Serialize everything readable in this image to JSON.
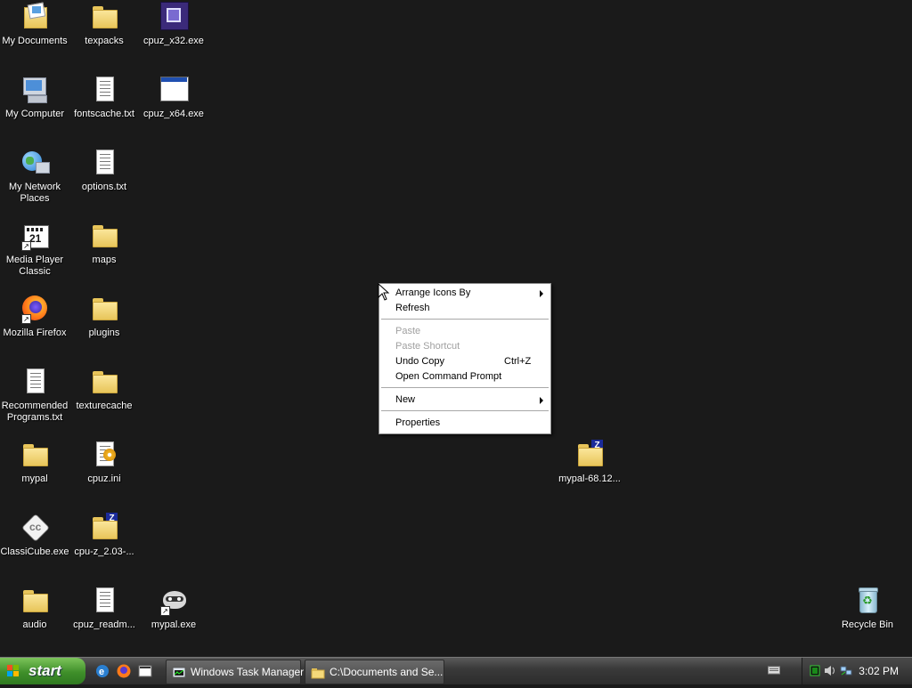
{
  "desktop": {
    "icons": [
      {
        "label": "My Documents",
        "icon": "my-documents-icon"
      },
      {
        "label": "texpacks",
        "icon": "folder-icon"
      },
      {
        "label": "cpuz_x32.exe",
        "icon": "cpuz-chip-icon"
      },
      {
        "label": "My Computer",
        "icon": "my-computer-icon"
      },
      {
        "label": "fontscache.txt",
        "icon": "text-file-icon"
      },
      {
        "label": "cpuz_x64.exe",
        "icon": "window-app-icon"
      },
      {
        "label": "My Network Places",
        "icon": "network-places-icon"
      },
      {
        "label": "options.txt",
        "icon": "text-file-icon"
      },
      {
        "label": "Media Player Classic",
        "icon": "media-player-classic-icon"
      },
      {
        "label": "maps",
        "icon": "folder-icon"
      },
      {
        "label": "Mozilla Firefox",
        "icon": "firefox-icon"
      },
      {
        "label": "plugins",
        "icon": "folder-icon"
      },
      {
        "label": "Recommended Programs.txt",
        "icon": "text-file-icon"
      },
      {
        "label": "texturecache",
        "icon": "folder-icon"
      },
      {
        "label": "mypal",
        "icon": "folder-icon"
      },
      {
        "label": "cpuz.ini",
        "icon": "ini-settings-icon"
      },
      {
        "label": "mypal-68.12...",
        "icon": "zip-folder-icon"
      },
      {
        "label": "ClassiCube.exe",
        "icon": "classicube-icon"
      },
      {
        "label": "cpu-z_2.03-...",
        "icon": "zip-folder-icon"
      },
      {
        "label": "audio",
        "icon": "folder-icon"
      },
      {
        "label": "cpuz_readm...",
        "icon": "text-file-icon"
      },
      {
        "label": "mypal.exe",
        "icon": "mypal-raccoon-icon"
      },
      {
        "label": "Recycle Bin",
        "icon": "recycle-bin-icon"
      }
    ]
  },
  "context_menu": {
    "items": [
      {
        "label": "Arrange Icons By",
        "submenu": true,
        "enabled": true
      },
      {
        "label": "Refresh",
        "enabled": true
      },
      {
        "label": "Paste",
        "enabled": false
      },
      {
        "label": "Paste Shortcut",
        "enabled": false
      },
      {
        "label": "Undo Copy",
        "shortcut": "Ctrl+Z",
        "enabled": true
      },
      {
        "label": "Open Command Prompt",
        "enabled": true
      },
      {
        "label": "New",
        "submenu": true,
        "enabled": true
      },
      {
        "label": "Properties",
        "enabled": true
      }
    ]
  },
  "taskbar": {
    "start_label": "start",
    "quick_launch": [
      "internet-explorer-icon",
      "firefox-icon",
      "media-player-classic-icon"
    ],
    "buttons": [
      {
        "label": "Windows Task Manager",
        "icon": "task-manager-icon"
      },
      {
        "label": "C:\\Documents and Se...",
        "icon": "folder-icon"
      }
    ],
    "tray": {
      "icons": [
        "keyboard-icon",
        "task-manager-tray-icon",
        "speaker-icon",
        "network-icon"
      ],
      "clock": "3:02 PM"
    }
  },
  "colors": {
    "desktop_bg": "#1a1a1a",
    "start_green": "#3f8f2a",
    "taskbar": "#3a3a3a",
    "zip_badge": "#1b2b9a"
  }
}
